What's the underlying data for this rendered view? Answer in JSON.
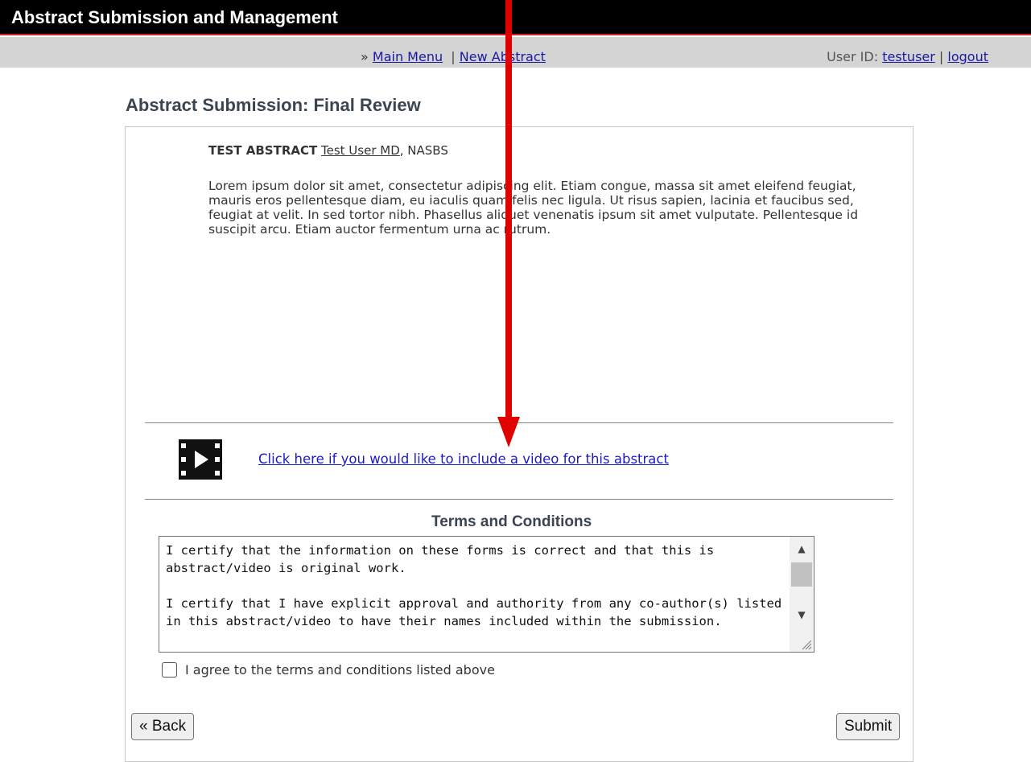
{
  "header": {
    "app_title": "Abstract Submission and Management"
  },
  "nav": {
    "prefix": "»",
    "main_menu": "Main Menu",
    "separator": "|",
    "new_abstract": "New Abstract",
    "user_id_label": "User ID:",
    "user_id": "testuser",
    "logout": "logout"
  },
  "page": {
    "title": "Abstract Submission: Final Review"
  },
  "abstract": {
    "title": "TEST ABSTRACT",
    "author": "Test User MD",
    "affiliation": ", NASBS",
    "body": "Lorem ipsum dolor sit amet, consectetur adipiscing elit. Etiam congue, massa sit amet eleifend feugiat, mauris eros pellentesque diam, eu iaculis quam felis nec ligula. Ut risus sapien, lacinia et faucibus sed, feugiat at velit. In sed tortor nibh. Phasellus aliquet venenatis ipsum sit amet vulputate. Pellentesque id suscipit arcu. Etiam auctor fermentum urna ac rutrum."
  },
  "video": {
    "icon": "video-icon",
    "link_text": "Click here if you would like to include a video for this abstract"
  },
  "terms": {
    "heading": "Terms and Conditions",
    "text": "I certify that the information on these forms is correct and that this is abstract/video is original work.\n\nI certify that I have explicit approval and authority from any co-author(s) listed in this abstract/video to have their names included within the submission."
  },
  "agree": {
    "label": "I agree to the terms and conditions listed above",
    "checked": false
  },
  "buttons": {
    "back": "« Back",
    "submit": "Submit"
  },
  "colors": {
    "header_bg": "#000000",
    "header_accent": "#cc2222",
    "nav_bg": "#d4d4d4",
    "link": "#1a1ac8",
    "annotation_arrow": "#e00000"
  }
}
